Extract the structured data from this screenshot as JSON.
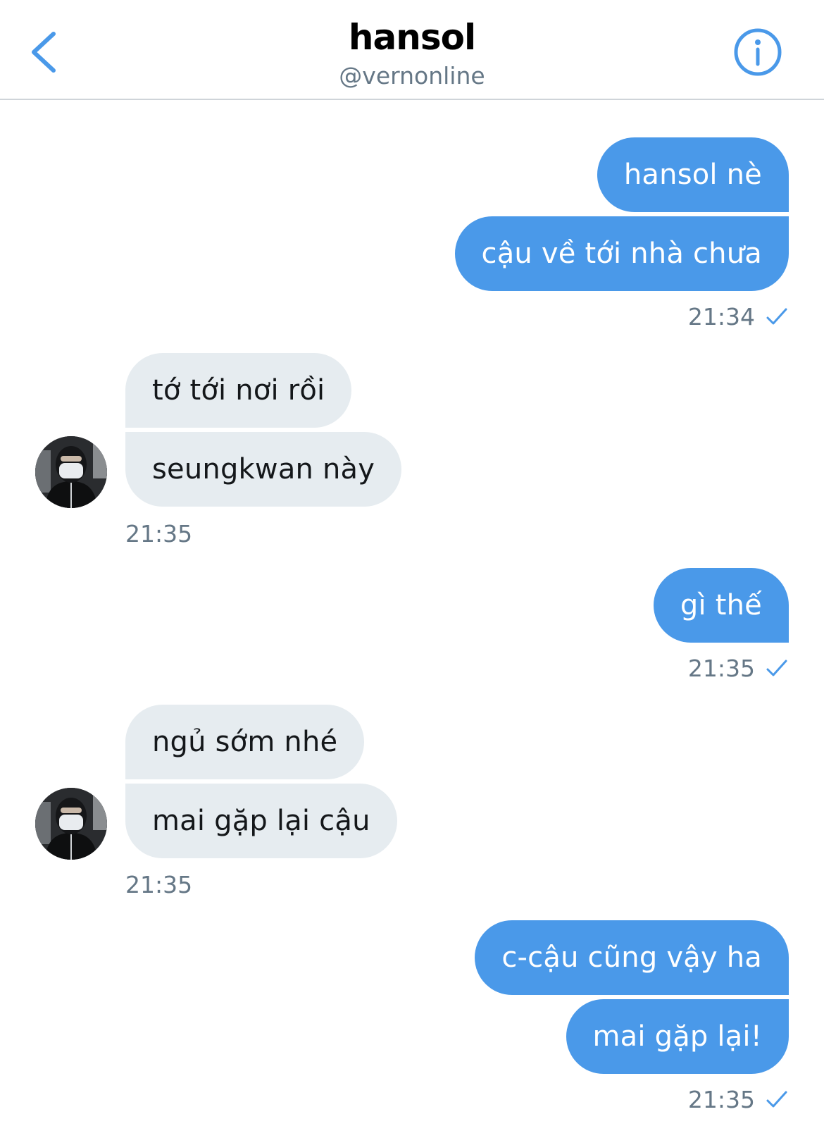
{
  "header": {
    "title": "hansol",
    "handle": "@vernonline",
    "back_icon": "chevron-left-icon",
    "info_icon": "info-circle-icon"
  },
  "colors": {
    "accent": "#4a99e9",
    "outgoing_bubble": "#4a99e9",
    "incoming_bubble": "#e6ecf0",
    "secondary_text": "#657786"
  },
  "messages": {
    "g1": {
      "m1": "hansol nè",
      "m2": "cậu về tới nhà chưa",
      "time": "21:34"
    },
    "g2": {
      "m1": "tớ tới nơi rồi",
      "m2": "seungkwan này",
      "time": "21:35"
    },
    "g3": {
      "m1": "gì thế",
      "time": "21:35"
    },
    "g4": {
      "m1": "ngủ sớm nhé",
      "m2": "mai gặp lại cậu",
      "time": "21:35"
    },
    "g5": {
      "m1": "c-cậu cũng vậy ha",
      "m2": "mai gặp lại!",
      "time": "21:35"
    }
  }
}
